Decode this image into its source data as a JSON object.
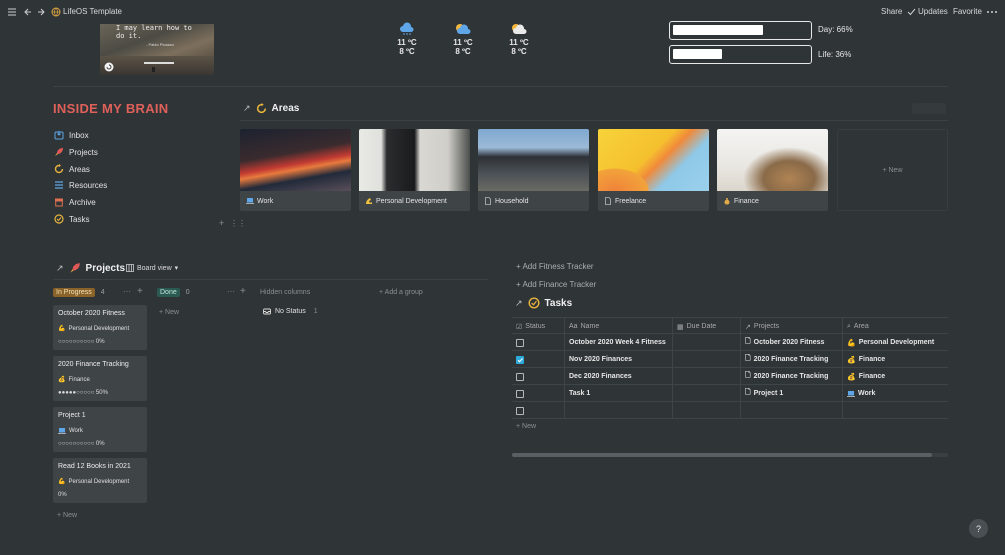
{
  "topbar": {
    "page_title": "LifeOS Template",
    "share_label": "Share",
    "updates_label": "Updates",
    "favorite_label": "Favorite"
  },
  "quote": {
    "text": "I may learn how to do it.",
    "author": "- Pablo Picasso"
  },
  "weather": [
    {
      "temp_high": "11 ºC",
      "temp_low": "8 ºC",
      "icon": "cloud-rain-icon"
    },
    {
      "temp_high": "11 ºC",
      "temp_low": "8 ºC",
      "icon": "partly-cloudy-icon"
    },
    {
      "temp_high": "11 ºC",
      "temp_low": "8 ºC",
      "icon": "partly-cloudy-icon"
    }
  ],
  "progress": {
    "day_label": "Day: 66%",
    "day_value": 0.66,
    "life_label": "Life: 36%",
    "life_value": 0.36
  },
  "brain": {
    "title": "INSIDE MY BRAIN",
    "items": [
      {
        "label": "Inbox",
        "icon": "inbox-icon"
      },
      {
        "label": "Projects",
        "icon": "rocket-icon"
      },
      {
        "label": "Areas",
        "icon": "refresh-icon"
      },
      {
        "label": "Resources",
        "icon": "list-icon"
      },
      {
        "label": "Archive",
        "icon": "archive-icon"
      },
      {
        "label": "Tasks",
        "icon": "check-circle-icon"
      }
    ]
  },
  "areas": {
    "title": "Areas",
    "new_label": "+ New",
    "cards": [
      {
        "name": "Work",
        "icon": "laptop-icon"
      },
      {
        "name": "Personal Development",
        "icon": "flexed-arm-icon"
      },
      {
        "name": "Household",
        "icon": "document-icon"
      },
      {
        "name": "Freelance",
        "icon": "document-icon"
      },
      {
        "name": "Finance",
        "icon": "money-bag-icon"
      }
    ]
  },
  "projects": {
    "title": "Projects",
    "view_label": "Board view",
    "in_progress": {
      "label": "In Progress",
      "count": "4"
    },
    "done": {
      "label": "Done",
      "count": "0"
    },
    "hidden_columns": "Hidden columns",
    "add_group": "+ Add a group",
    "no_status": {
      "label": "No Status",
      "count": "1"
    },
    "new_label": "+ New",
    "cards": [
      {
        "title": "October 2020 Fitness",
        "area": "Personal Development",
        "area_icon": "flexed-arm-icon",
        "progress": "○○○○○○○○○○ 0%"
      },
      {
        "title": "2020 Finance Tracking",
        "area": "Finance",
        "area_icon": "money-bag-icon",
        "progress": "●●●●●○○○○○ 50%"
      },
      {
        "title": "Project 1",
        "area": "Work",
        "area_icon": "laptop-icon",
        "progress": "○○○○○○○○○○ 0%"
      },
      {
        "title": "Read 12 Books in 2021",
        "area": "Personal Development",
        "area_icon": "flexed-arm-icon",
        "progress": "0%"
      }
    ]
  },
  "trackers": {
    "fitness": "+ Add Fitness Tracker",
    "finance": "+ Add Finance Tracker"
  },
  "tasks": {
    "title": "Tasks",
    "columns": [
      "Status",
      "Name",
      "Due Date",
      "Projects",
      "Area"
    ],
    "rows": [
      {
        "done": false,
        "name": "October 2020 Week 4 Fitness",
        "due": "",
        "project": "October 2020 Fitness",
        "area": "Personal Development",
        "area_icon": "flexed-arm-icon"
      },
      {
        "done": true,
        "name": "Nov 2020 Finances",
        "due": "",
        "project": "2020 Finance Tracking",
        "area": "Finance",
        "area_icon": "money-bag-icon"
      },
      {
        "done": false,
        "name": "Dec 2020 Finances",
        "due": "",
        "project": "2020 Finance Tracking",
        "area": "Finance",
        "area_icon": "money-bag-icon"
      },
      {
        "done": false,
        "name": "Task 1",
        "due": "",
        "project": "Project 1",
        "area": "Work",
        "area_icon": "laptop-icon"
      },
      {
        "done": false,
        "name": "",
        "due": "",
        "project": "",
        "area": "",
        "area_icon": ""
      }
    ],
    "new_label": "+ New"
  },
  "help_label": "?"
}
